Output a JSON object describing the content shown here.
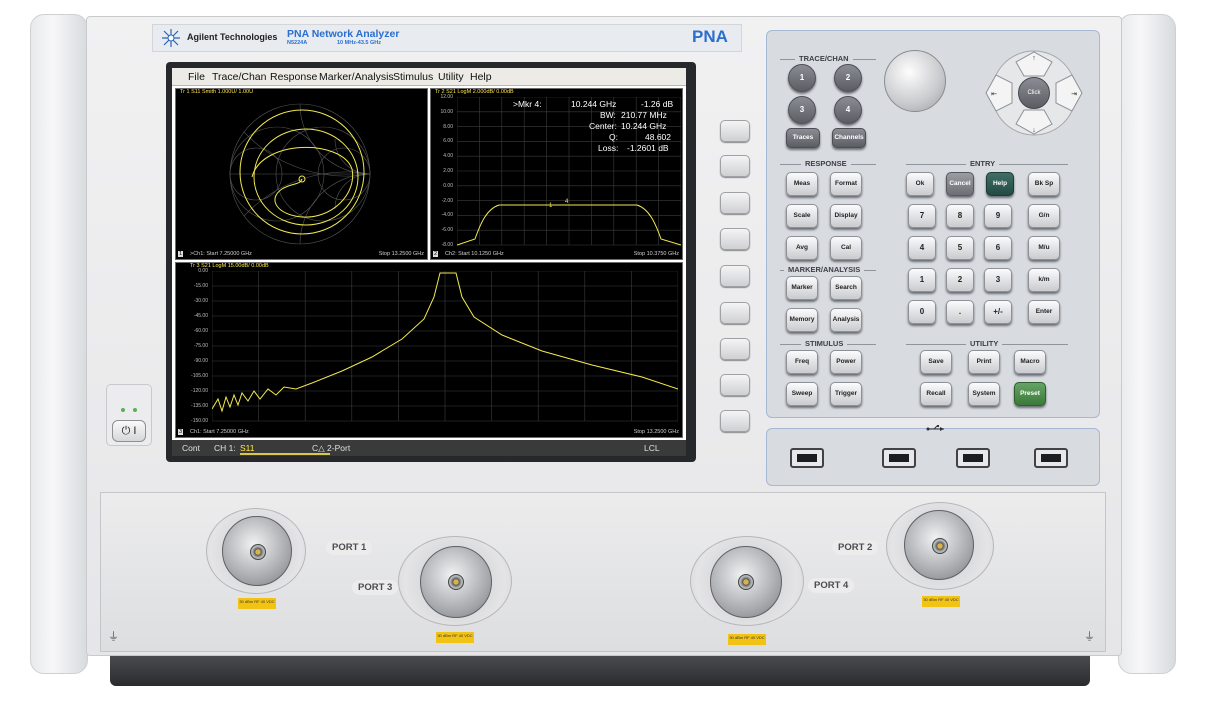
{
  "brand": {
    "company": "Agilent Technologies",
    "product_name": "PNA Network Analyzer",
    "model": "N5224A",
    "range": "10 MHz-43.5 GHz",
    "badge": "PNA"
  },
  "menu": [
    "File",
    "Trace/Chan",
    "Response",
    "Marker/Analysis",
    "Stimulus",
    "Utility",
    "Help"
  ],
  "pane_smith": {
    "header": "Tr 1  S11 Smith 1.000U/  1.00U",
    "footer_left": ">Ch1: Start  7.25000 GHz",
    "footer_right": "Stop  13.2500 GHz",
    "index": "1"
  },
  "pane_s21": {
    "header": "Tr 2  S21 LogM 2.000dB/  0.00dB",
    "footer_left": "Ch2: Start  10.1250 GHz",
    "footer_right": "Stop  10.3750 GHz",
    "index": "2",
    "y_ticks": [
      "12.00",
      "10.00",
      "8.00",
      "6.00",
      "4.00",
      "2.00",
      "0.00",
      "-2.00",
      "-4.00",
      "-6.00",
      "-8.00"
    ],
    "marker_readout": [
      {
        "label": ">Mkr 4:",
        "freq": "10.244 GHz",
        "value": "-1.26 dB"
      },
      {
        "label": "BW:",
        "value": "210.77 MHz"
      },
      {
        "label": "Center:",
        "value": "10.244 GHz"
      },
      {
        "label": "Q:",
        "value": "48.602"
      },
      {
        "label": "Loss:",
        "value": "-1.2601 dB"
      }
    ]
  },
  "pane_log": {
    "header": "Tr 3  S21 LogM 15.00dB/  0.00dB",
    "footer_left": "Ch1: Start  7.25000 GHz",
    "footer_right": "Stop  13.2500 GHz",
    "index": "3",
    "y_ticks": [
      "0.00",
      "-15.00",
      "-30.00",
      "-45.00",
      "-60.00",
      "-75.00",
      "-90.00",
      "-105.00",
      "-120.00",
      "-135.00",
      "-150.00"
    ]
  },
  "status": {
    "mode": "Cont",
    "channel": "CH 1:",
    "param": "S11",
    "cal": "C△ 2-Port",
    "remote": "LCL"
  },
  "panel": {
    "trace_chan_label": "TRACE/CHAN",
    "trace_keys": [
      "1",
      "2",
      "3",
      "4"
    ],
    "traces_label": "Traces",
    "channels_label": "Channels",
    "response_label": "RESPONSE",
    "response_keys": [
      "Meas",
      "Format",
      "Scale",
      "Display",
      "Avg",
      "Cal"
    ],
    "marker_label": "MARKER/ANALYSIS",
    "marker_keys": [
      "Marker",
      "Search",
      "Memory",
      "Analysis"
    ],
    "stimulus_label": "STIMULUS",
    "stimulus_keys": [
      "Freq",
      "Power",
      "Sweep",
      "Trigger"
    ],
    "entry_label": "ENTRY",
    "entry_top": [
      "Ok",
      "Cancel",
      "Help",
      "Bk Sp"
    ],
    "entry_rows": [
      [
        "7",
        "8",
        "9",
        "G/n"
      ],
      [
        "4",
        "5",
        "6",
        "M/u"
      ],
      [
        "1",
        "2",
        "3",
        "k/m"
      ],
      [
        "0",
        ".",
        "+/-",
        "Enter"
      ]
    ],
    "utility_label": "UTILITY",
    "utility_keys": [
      "Save",
      "Print",
      "Macro",
      "Recall",
      "System",
      "Preset"
    ],
    "click_label": "Click"
  },
  "ports": {
    "port1": "PORT 1",
    "port2": "PORT 2",
    "port3": "PORT 3",
    "port4": "PORT 4",
    "warning": "30 dBm RF 40 VDC"
  },
  "power_label": "⏻ I"
}
